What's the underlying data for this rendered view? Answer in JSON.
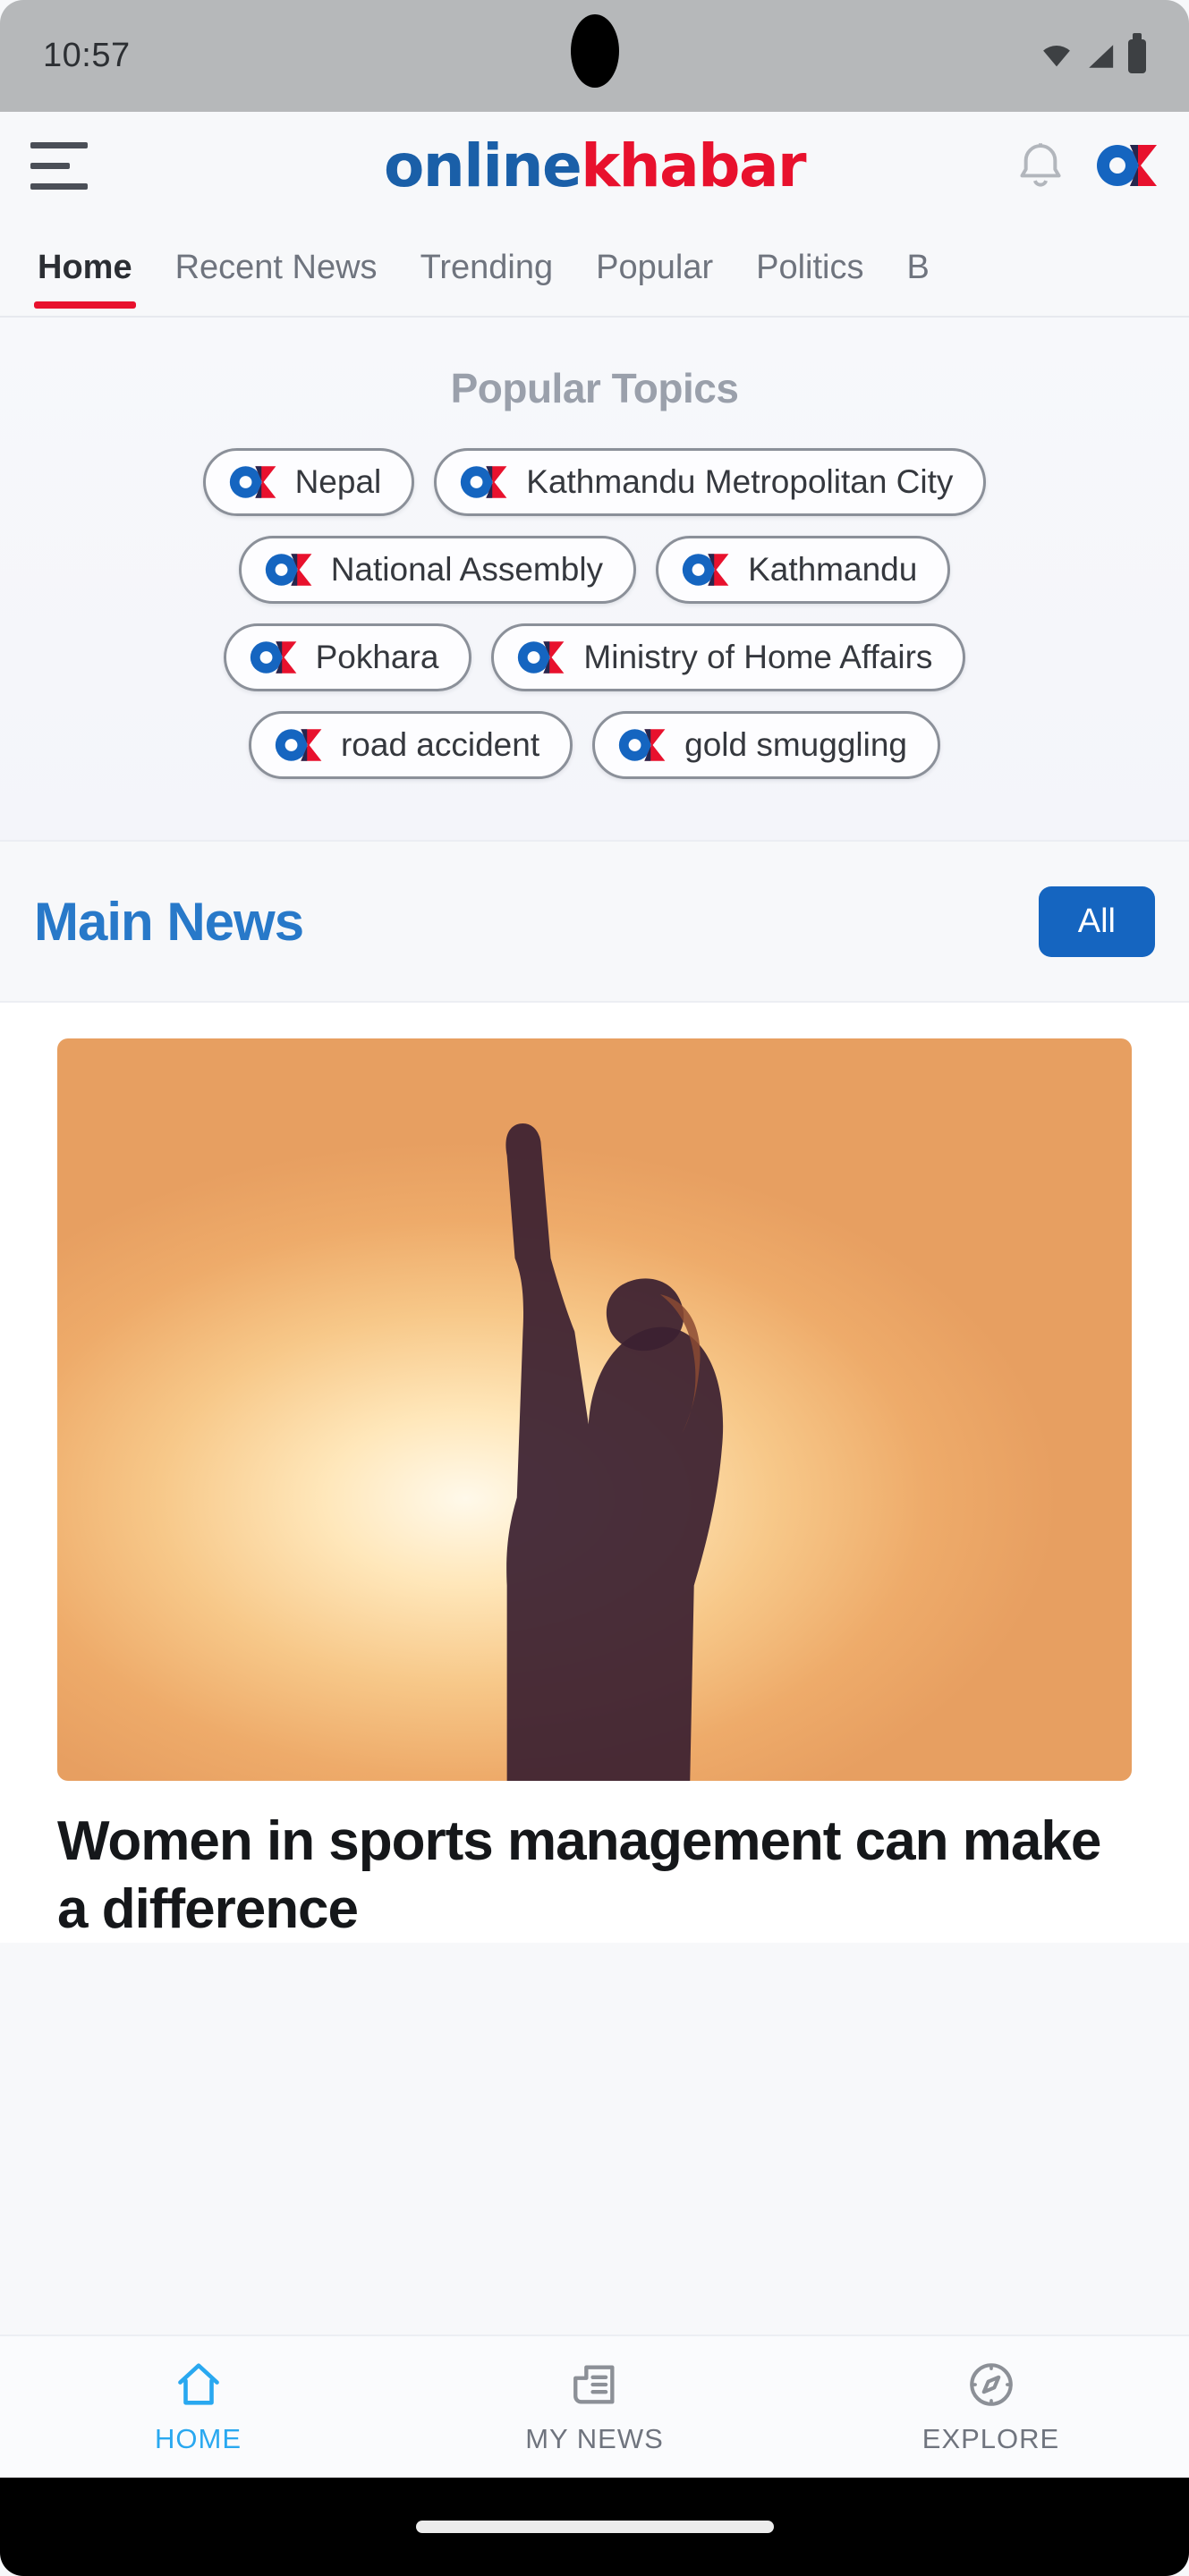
{
  "status_bar": {
    "time": "10:57",
    "icons": [
      "wifi-icon",
      "signal-icon",
      "battery-icon"
    ]
  },
  "header": {
    "menu_icon": "hamburger-menu-icon",
    "brand_part1": "online",
    "brand_part2": "khabar",
    "notification_icon": "bell-icon",
    "logo_icon": "onlinekhabar-ok-logo-icon",
    "brand_blue": "#1a5fa8",
    "brand_red": "#e8112d"
  },
  "tabs": {
    "items": [
      {
        "label": "Home",
        "active": true
      },
      {
        "label": "Recent News",
        "active": false
      },
      {
        "label": "Trending",
        "active": false
      },
      {
        "label": "Popular",
        "active": false
      },
      {
        "label": "Politics",
        "active": false
      },
      {
        "label": "B",
        "active": false
      }
    ],
    "active_underline_color": "#e8112d"
  },
  "popular_topics": {
    "title": "Popular Topics",
    "rows": [
      [
        {
          "label": "Nepal"
        },
        {
          "label": "Kathmandu Metropolitan City"
        }
      ],
      [
        {
          "label": "National Assembly"
        },
        {
          "label": "Kathmandu"
        }
      ],
      [
        {
          "label": "Pokhara"
        },
        {
          "label": "Ministry of Home Affairs"
        }
      ],
      [
        {
          "label": "road accident"
        },
        {
          "label": "gold smuggling"
        }
      ]
    ]
  },
  "main_news": {
    "title": "Main News",
    "title_color": "#2879c9",
    "filter_button": "All",
    "filter_button_color": "#1565c0"
  },
  "article": {
    "image_alt": "silhouette of woman raising fist at sunset",
    "title": "Women in sports management can make a difference"
  },
  "bottom_nav": {
    "items": [
      {
        "label": "HOME",
        "icon": "home-icon",
        "active": true
      },
      {
        "label": "MY NEWS",
        "icon": "newspaper-icon",
        "active": false
      },
      {
        "label": "EXPLORE",
        "icon": "compass-icon",
        "active": false
      }
    ],
    "active_color": "#29a8f0",
    "inactive_color": "#6f747e"
  }
}
